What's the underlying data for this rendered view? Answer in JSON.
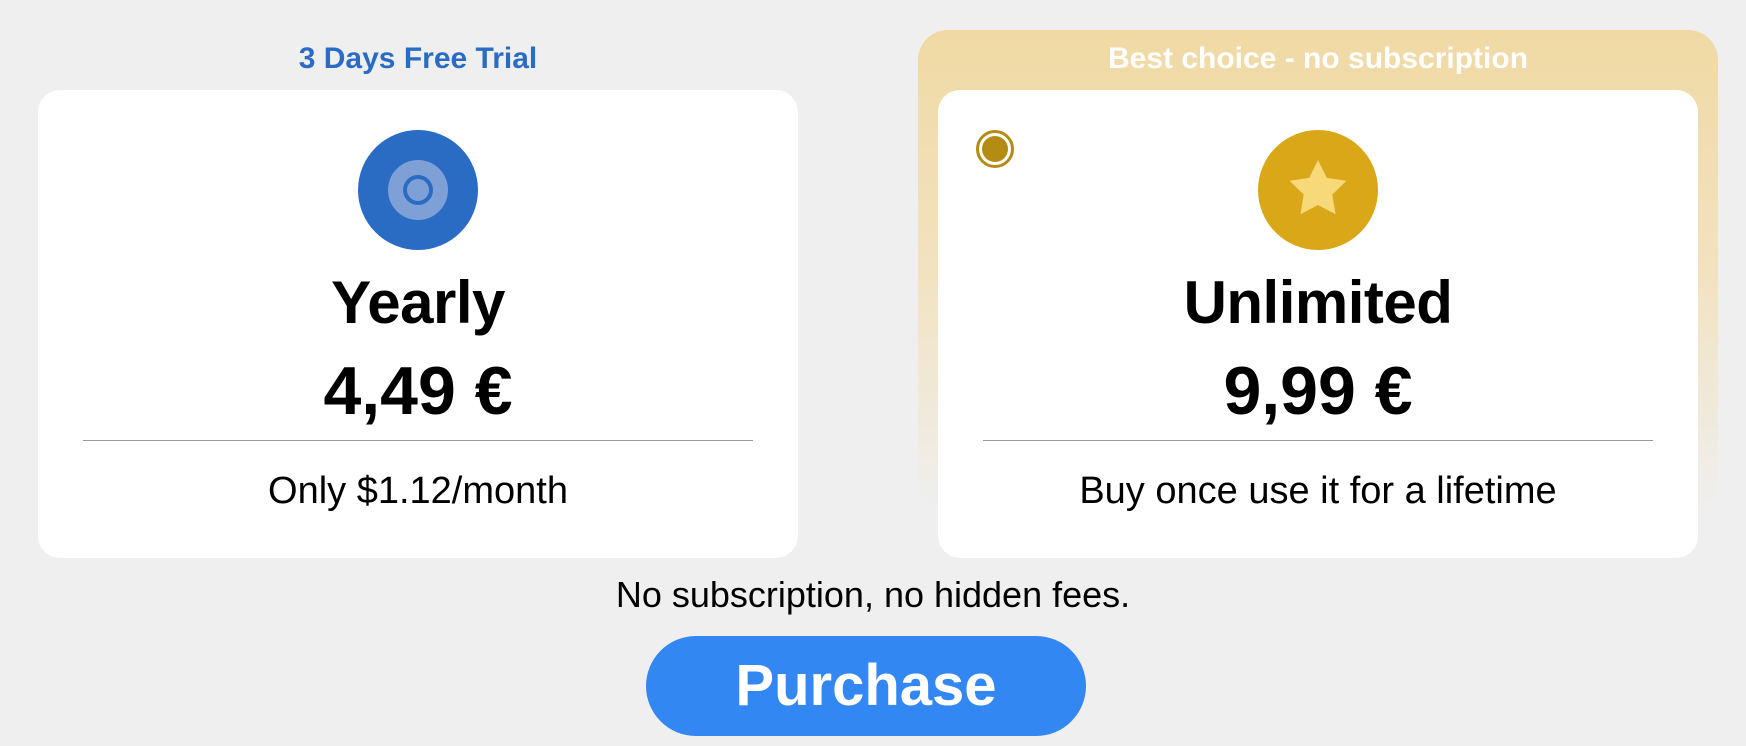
{
  "yearly_plan": {
    "badge": "3 Days Free Trial",
    "title": "Yearly",
    "price": "4,49 €",
    "description": "Only $1.12/month",
    "icon": "target-icon",
    "color": "#2a6cc4"
  },
  "unlimited_plan": {
    "badge": "Best choice - no subscription",
    "title": "Unlimited",
    "price": "9,99 €",
    "description": "Buy once use it for a lifetime",
    "icon": "star-icon",
    "color": "#d9a717",
    "selected": true
  },
  "footnote": "No subscription, no hidden fees.",
  "purchase_button": {
    "label": "Purchase",
    "color": "#3387f2"
  }
}
